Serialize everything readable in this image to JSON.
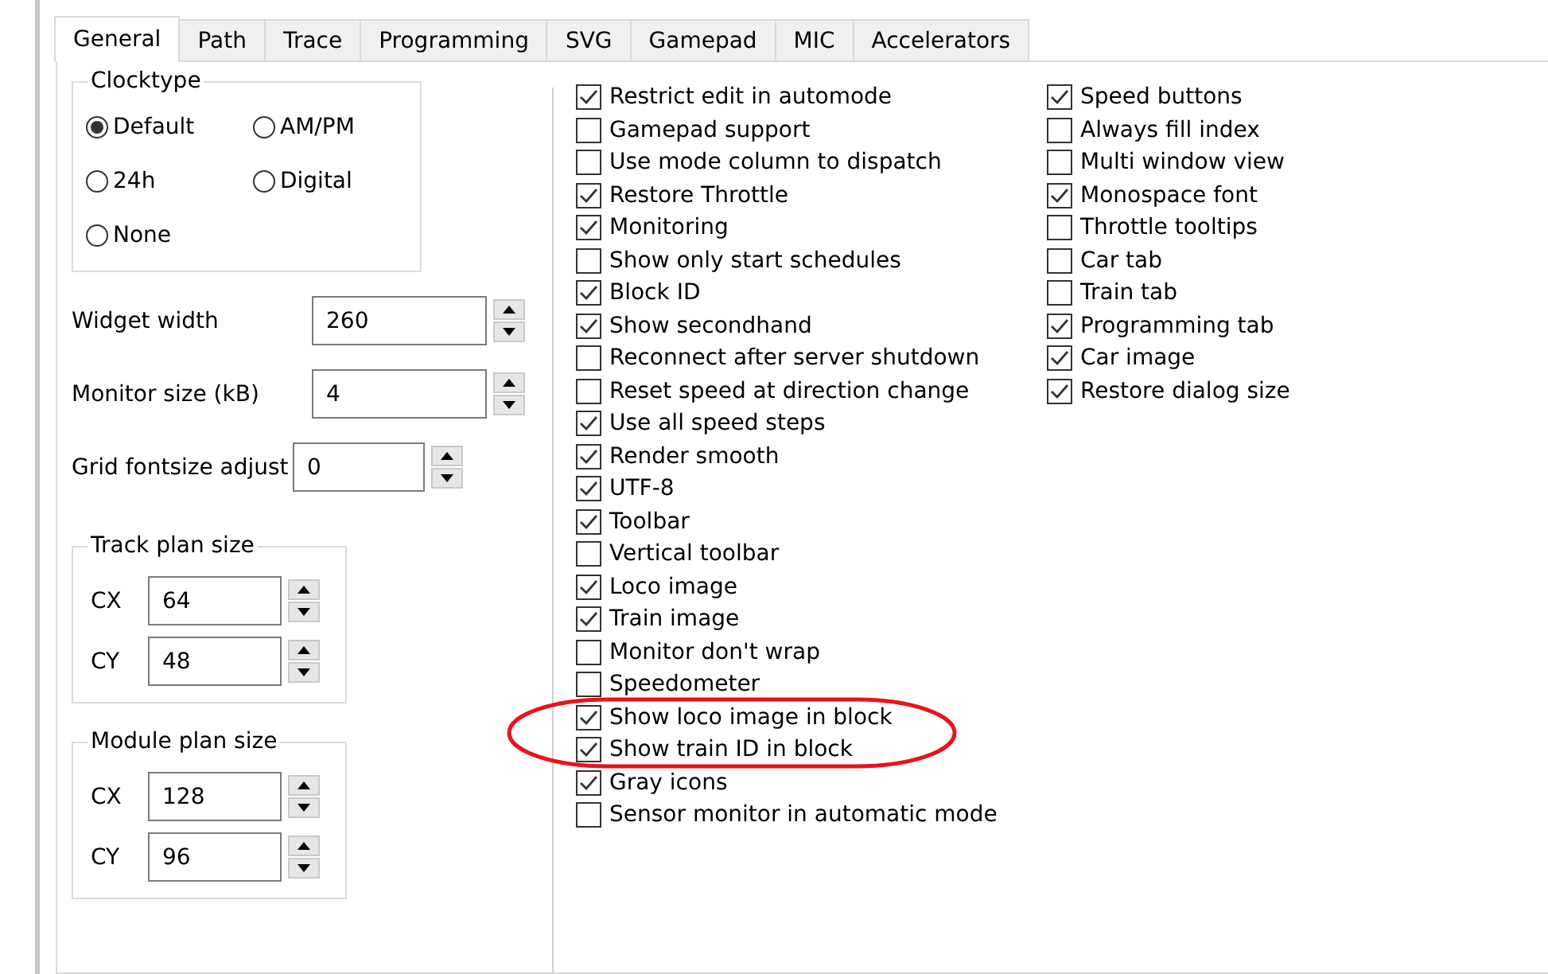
{
  "tabs": [
    {
      "label": "General",
      "selected": true
    },
    {
      "label": "Path",
      "selected": false
    },
    {
      "label": "Trace",
      "selected": false
    },
    {
      "label": "Programming",
      "selected": false
    },
    {
      "label": "SVG",
      "selected": false
    },
    {
      "label": "Gamepad",
      "selected": false
    },
    {
      "label": "MIC",
      "selected": false
    },
    {
      "label": "Accelerators",
      "selected": false
    }
  ],
  "clocktype": {
    "title": "Clocktype",
    "options": [
      {
        "label": "Default",
        "selected": true
      },
      {
        "label": "AM/PM",
        "selected": false
      },
      {
        "label": "24h",
        "selected": false
      },
      {
        "label": "Digital",
        "selected": false
      },
      {
        "label": "None",
        "selected": false
      }
    ]
  },
  "spin_fields": [
    {
      "label": "Widget width",
      "value": "260"
    },
    {
      "label": "Monitor size (kB)",
      "value": "4"
    },
    {
      "label": "Grid fontsize adjust",
      "value": "0"
    }
  ],
  "size_groups": [
    {
      "title": "Track plan size",
      "fields": [
        {
          "label": "CX",
          "value": "64"
        },
        {
          "label": "CY",
          "value": "48"
        }
      ]
    },
    {
      "title": "Module plan size",
      "fields": [
        {
          "label": "CX",
          "value": "128"
        },
        {
          "label": "CY",
          "value": "96"
        }
      ]
    }
  ],
  "option_columns": [
    [
      {
        "label": "Restrict edit in automode",
        "checked": true
      },
      {
        "label": "Gamepad support",
        "checked": false
      },
      {
        "label": "Use mode column to dispatch",
        "checked": false
      },
      {
        "label": "Restore Throttle",
        "checked": true
      },
      {
        "label": "Monitoring",
        "checked": true
      },
      {
        "label": "Show only start schedules",
        "checked": false
      },
      {
        "label": "Block ID",
        "checked": true
      },
      {
        "label": "Show secondhand",
        "checked": true
      },
      {
        "label": "Reconnect after server shutdown",
        "checked": false
      },
      {
        "label": "Reset speed at direction change",
        "checked": false
      },
      {
        "label": "Use all speed steps",
        "checked": true
      },
      {
        "label": "Render smooth",
        "checked": true
      },
      {
        "label": "UTF-8",
        "checked": true
      },
      {
        "label": "Toolbar",
        "checked": true
      },
      {
        "label": "Vertical toolbar",
        "checked": false
      },
      {
        "label": "Loco image",
        "checked": true
      },
      {
        "label": "Train image",
        "checked": true
      },
      {
        "label": "Monitor don't wrap",
        "checked": false
      },
      {
        "label": "Speedometer",
        "checked": false
      },
      {
        "label": "Show loco image in block",
        "checked": true
      },
      {
        "label": "Show train ID in block",
        "checked": true
      },
      {
        "label": "Gray icons",
        "checked": true
      },
      {
        "label": "Sensor monitor in automatic mode",
        "checked": false
      }
    ],
    [
      {
        "label": "Speed buttons",
        "checked": true
      },
      {
        "label": "Always fill index",
        "checked": false
      },
      {
        "label": "Multi window view",
        "checked": false
      },
      {
        "label": "Monospace font",
        "checked": true
      },
      {
        "label": "Throttle tooltips",
        "checked": false
      },
      {
        "label": "Car tab",
        "checked": false
      },
      {
        "label": "Train tab",
        "checked": false
      },
      {
        "label": "Programming tab",
        "checked": true
      },
      {
        "label": "Car image",
        "checked": true
      },
      {
        "label": "Restore dialog size",
        "checked": true
      }
    ]
  ]
}
